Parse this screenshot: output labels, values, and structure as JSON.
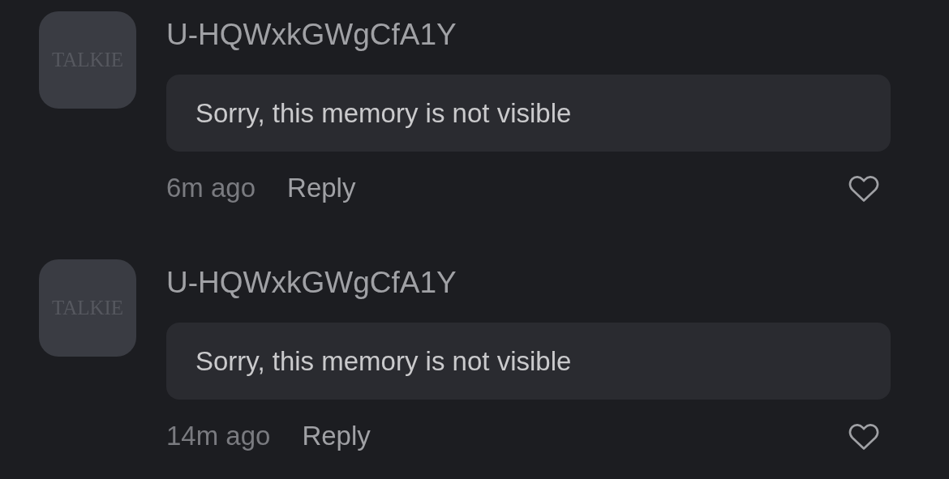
{
  "comments": [
    {
      "avatar": {
        "logo": "TALKIE"
      },
      "author": "U-HQWxkGWgCfA1Y",
      "text": "Sorry, this memory is not visible",
      "time": "6m ago",
      "reply": "Reply",
      "liked": false
    },
    {
      "avatar": {
        "logo": "TALKIE"
      },
      "author": "U-HQWxkGWgCfA1Y",
      "text": "Sorry, this memory is not visible",
      "time": "14m ago",
      "reply": "Reply",
      "liked": false
    }
  ]
}
